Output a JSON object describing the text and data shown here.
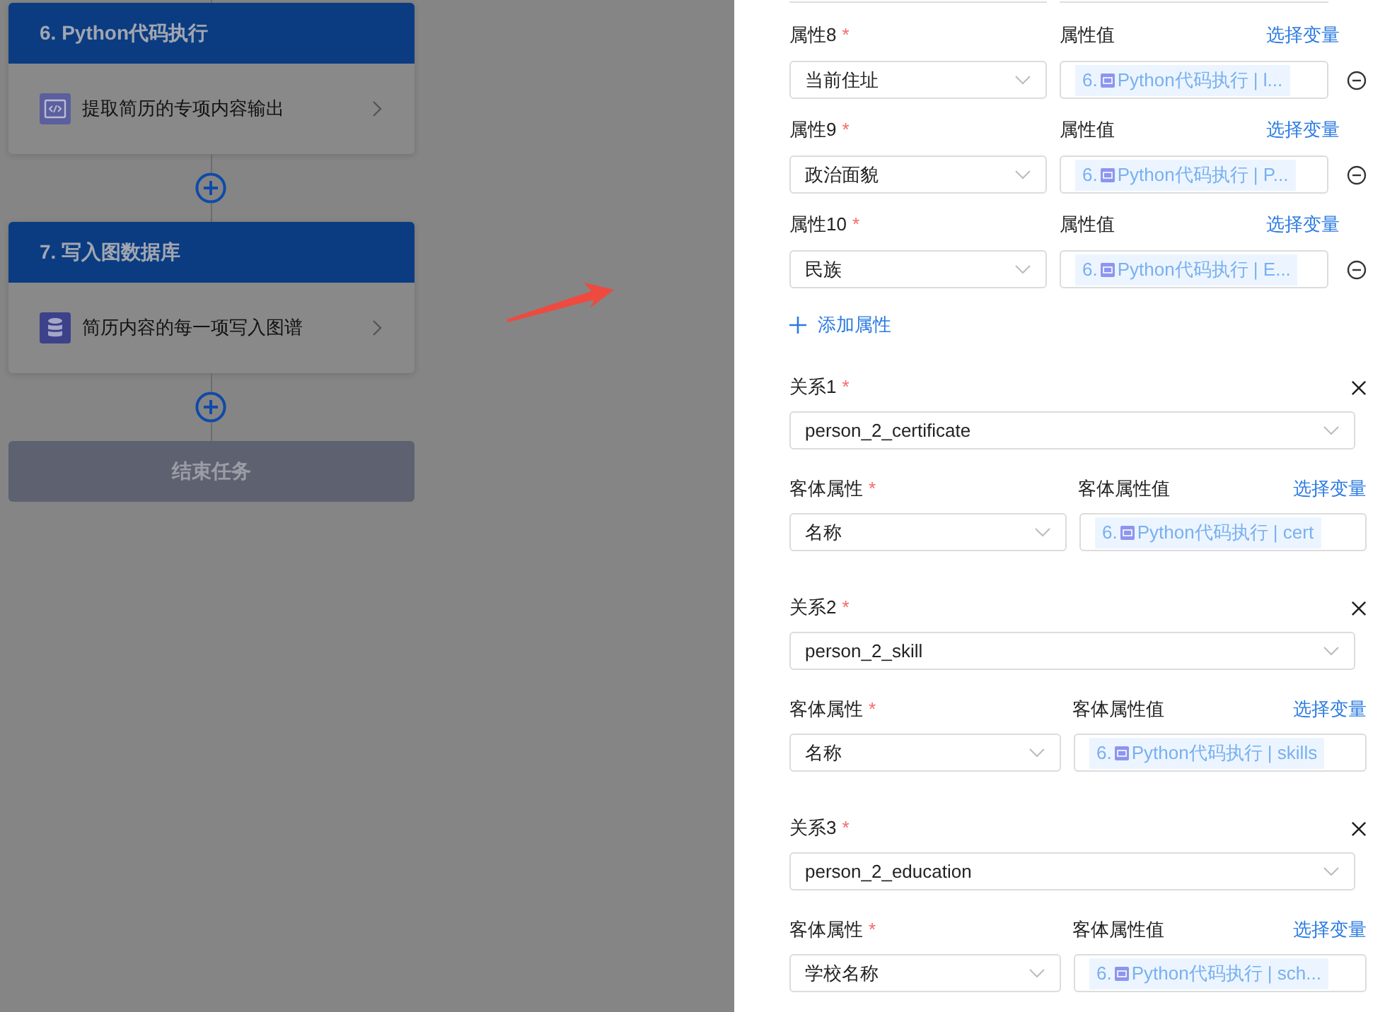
{
  "flow": {
    "nodes": [
      {
        "kind": "node",
        "title": "6. Python代码执行",
        "step": "提取简历的专项内容输出"
      },
      {
        "kind": "node",
        "title": "7. 写入图数据库",
        "step": "简历内容的每一项写入图谱"
      },
      {
        "kind": "end",
        "title": "结束任务"
      }
    ]
  },
  "attributes": [
    {
      "label": "属性8",
      "required_mark": "*",
      "value_label": "属性值",
      "link": "选择变量",
      "key": "当前住址",
      "tag_prefix": "6.",
      "tag_text": "Python代码执行 | l..."
    },
    {
      "label": "属性9",
      "required_mark": "*",
      "value_label": "属性值",
      "link": "选择变量",
      "key": "政治面貌",
      "tag_prefix": "6.",
      "tag_text": "Python代码执行 | P..."
    },
    {
      "label": "属性10",
      "required_mark": "*",
      "value_label": "属性值",
      "link": "选择变量",
      "key": "民族",
      "tag_prefix": "6.",
      "tag_text": "Python代码执行 | E..."
    }
  ],
  "add_attribute": "添加属性",
  "relations": [
    {
      "label": "关系1",
      "required_mark": "*",
      "value": "person_2_certificate",
      "object_label": "客体属性",
      "object_required_mark": "*",
      "object_value_label": "客体属性值",
      "link": "选择变量",
      "object_key": "名称",
      "tag_prefix": "6.",
      "tag_text": "Python代码执行 | cert"
    },
    {
      "label": "关系2",
      "required_mark": "*",
      "value": "person_2_skill",
      "object_label": "客体属性",
      "object_required_mark": "*",
      "object_value_label": "客体属性值",
      "link": "选择变量",
      "object_key": "名称",
      "tag_prefix": "6.",
      "tag_text": "Python代码执行 | skills"
    },
    {
      "label": "关系3",
      "required_mark": "*",
      "value": "person_2_education",
      "object_label": "客体属性",
      "object_required_mark": "*",
      "object_value_label": "客体属性值",
      "link": "选择变量",
      "object_key": "学校名称",
      "tag_prefix": "6.",
      "tag_text": "Python代码执行 | sch..."
    }
  ]
}
